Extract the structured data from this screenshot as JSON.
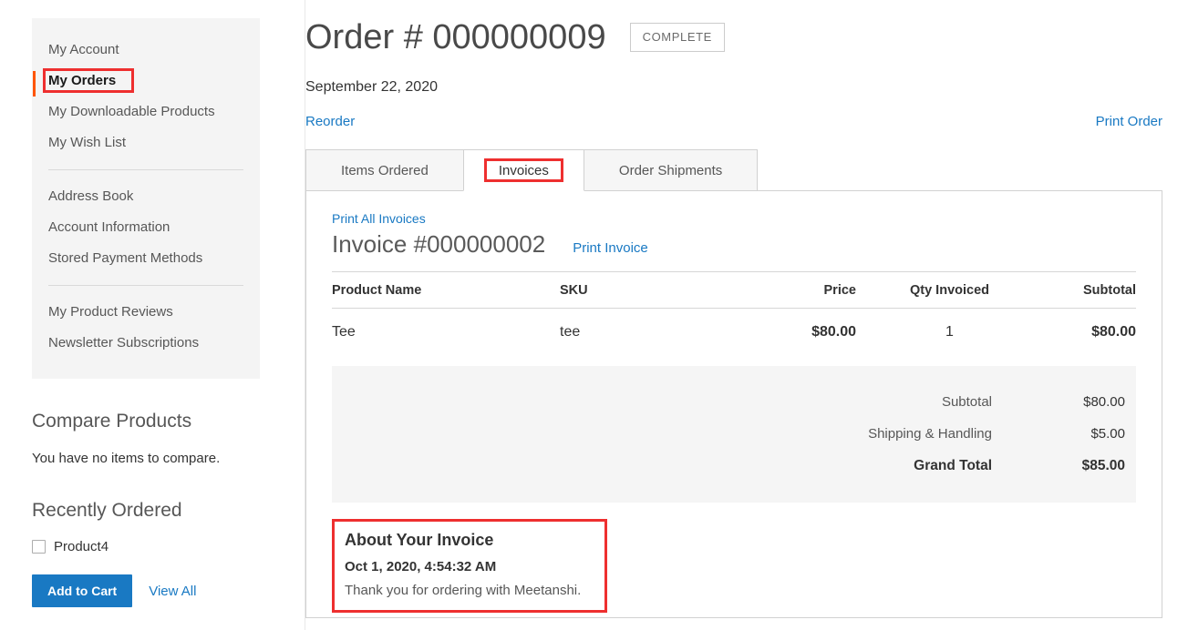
{
  "sidebar": {
    "groups": [
      {
        "items": [
          {
            "label": "My Account",
            "current": false
          },
          {
            "label": "My Orders",
            "current": true
          },
          {
            "label": "My Downloadable Products",
            "current": false
          },
          {
            "label": "My Wish List",
            "current": false
          }
        ]
      },
      {
        "items": [
          {
            "label": "Address Book",
            "current": false
          },
          {
            "label": "Account Information",
            "current": false
          },
          {
            "label": "Stored Payment Methods",
            "current": false
          }
        ]
      },
      {
        "items": [
          {
            "label": "My Product Reviews",
            "current": false
          },
          {
            "label": "Newsletter Subscriptions",
            "current": false
          }
        ]
      }
    ],
    "compare": {
      "title": "Compare Products",
      "empty_text": "You have no items to compare."
    },
    "recently_ordered": {
      "title": "Recently Ordered",
      "items": [
        {
          "label": "Product4",
          "checked": false
        }
      ],
      "add_to_cart_label": "Add to Cart",
      "view_all_label": "View All"
    }
  },
  "order": {
    "title": "Order # 000000009",
    "status": "COMPLETE",
    "date": "September 22, 2020",
    "reorder_label": "Reorder",
    "print_order_label": "Print Order"
  },
  "tabs": [
    {
      "label": "Items Ordered",
      "active": false,
      "highlighted": false
    },
    {
      "label": "Invoices",
      "active": true,
      "highlighted": true
    },
    {
      "label": "Order Shipments",
      "active": false,
      "highlighted": false
    }
  ],
  "invoice": {
    "print_all_label": "Print All Invoices",
    "title": "Invoice #000000002",
    "print_invoice_label": "Print Invoice",
    "columns": [
      "Product Name",
      "SKU",
      "Price",
      "Qty Invoiced",
      "Subtotal"
    ],
    "rows": [
      {
        "name": "Tee",
        "sku": "tee",
        "price": "$80.00",
        "qty": "1",
        "subtotal": "$80.00"
      }
    ],
    "totals": [
      {
        "label": "Subtotal",
        "value": "$80.00",
        "grand": false
      },
      {
        "label": "Shipping & Handling",
        "value": "$5.00",
        "grand": false
      },
      {
        "label": "Grand Total",
        "value": "$85.00",
        "grand": true
      }
    ],
    "about": {
      "title": "About Your Invoice",
      "date": "Oct 1, 2020, 4:54:32 AM",
      "message": "Thank you for ordering with Meetanshi."
    }
  },
  "colors": {
    "accent_orange": "#ff5501",
    "link_blue": "#1979c3",
    "highlight_red": "#ee2f2f",
    "panel_gray": "#f4f4f4",
    "totals_gray": "#f5f5f5"
  }
}
